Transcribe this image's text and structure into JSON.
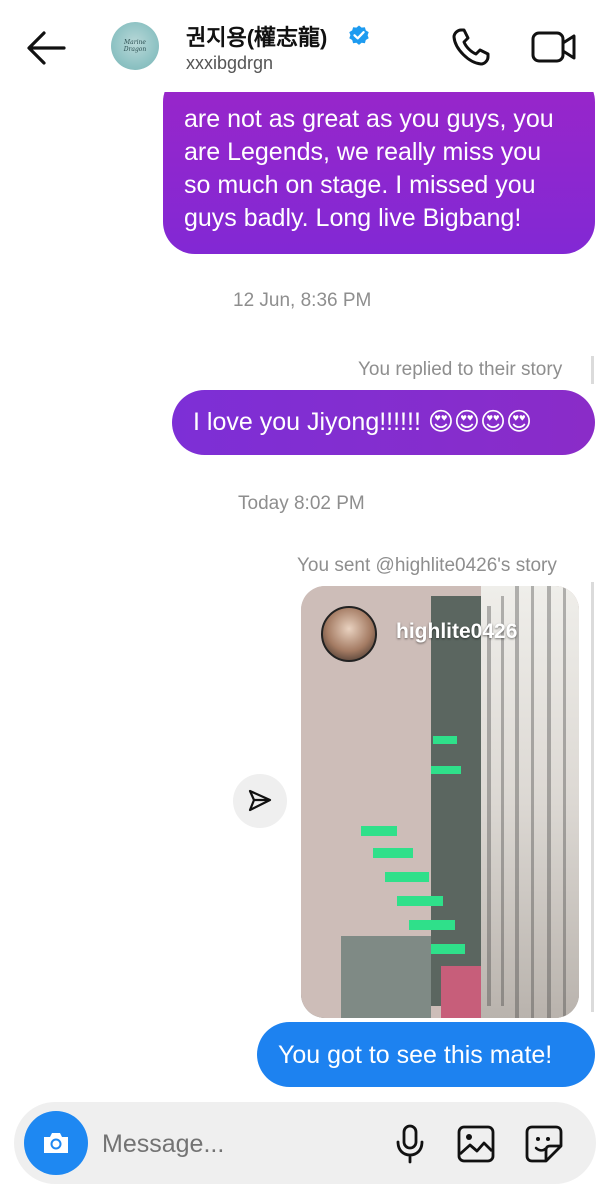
{
  "header": {
    "back_icon": "arrow-left-icon",
    "avatar_caption": "Marine Dragon",
    "title": "권지용(權志龍)",
    "verified_icon": "verified-badge-icon",
    "subtitle": "xxxibgdrgn",
    "call_icon": "phone-icon",
    "video_icon": "video-camera-icon"
  },
  "thread": {
    "message_1": {
      "lines": [
        "are not as great as you guys, you",
        "are Legends, we really miss you",
        "so much on stage. I missed you",
        "guys badly. Long live Bigbang!"
      ],
      "gradient": [
        "#9a26c9",
        "#8228d4"
      ]
    },
    "timestamp_1": "12 Jun, 8:36 PM",
    "reply_label": "You replied to their story",
    "message_2": {
      "text": "I love you Jiyong!!!!!! 😍😍😍😍"
    },
    "timestamp_2": "Today 8:02 PM",
    "shared_label": "You sent @highlite0426's story",
    "story": {
      "username": "highlite0426",
      "share_icon": "send-icon"
    },
    "message_3": {
      "text": "You got to see this mate!",
      "color": "#1d82f0"
    }
  },
  "composer": {
    "camera_icon": "camera-icon",
    "placeholder": "Message...",
    "mic_icon": "microphone-icon",
    "gallery_icon": "image-icon",
    "sticker_icon": "sticker-icon",
    "accent": "#1e88f2"
  }
}
